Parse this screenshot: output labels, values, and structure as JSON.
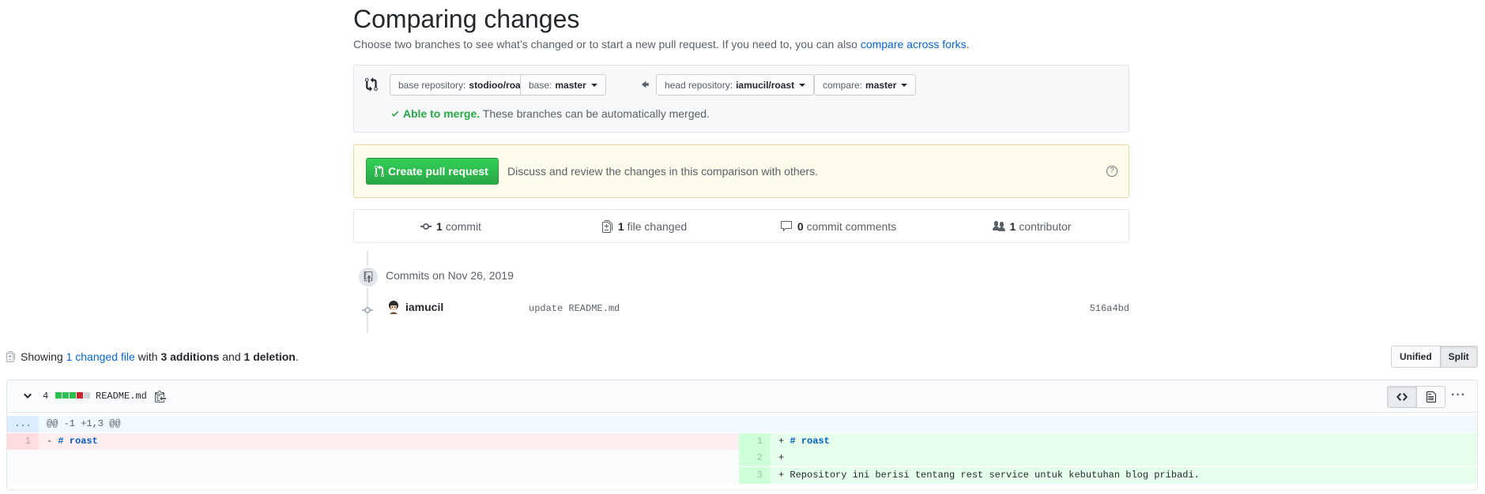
{
  "header": {
    "title": "Comparing changes",
    "subtitle_text": "Choose two branches to see what’s changed or to start a new pull request. If you need to, you can also",
    "subtitle_link": "compare across forks",
    "subtitle_end": "."
  },
  "range": {
    "base_repo_label": "base repository:",
    "base_repo_value": "stodioo/roast",
    "base_label": "base:",
    "base_value": "master",
    "head_repo_label": "head repository:",
    "head_repo_value": "iamucil/roast",
    "compare_label": "compare:",
    "compare_value": "master",
    "merge_ok": "Able to merge.",
    "merge_text": "These branches can be automatically merged."
  },
  "pull_request": {
    "button_label": "Create pull request",
    "description": "Discuss and review the changes in this comparison with others.",
    "help_glyph": "?"
  },
  "stats": {
    "commits_count": "1",
    "commits_label": "commit",
    "files_count": "1",
    "files_label": "file changed",
    "comments_count": "0",
    "comments_label": "commit comments",
    "contributors_count": "1",
    "contributors_label": "contributor"
  },
  "commits": {
    "date_heading": "Commits on Nov 26, 2019",
    "items": [
      {
        "author": "iamucil",
        "message": "update README.md",
        "sha": "516a4bd"
      }
    ]
  },
  "summary": {
    "prefix": "Showing",
    "files_link": "1 changed file",
    "with": "with",
    "additions": "3 additions",
    "and": "and",
    "deletions": "1 deletion",
    "end": "."
  },
  "view_toggle": {
    "unified": "Unified",
    "split": "Split",
    "selected": "Split"
  },
  "file": {
    "diff_count": "4",
    "name": "README.md",
    "diffstat_blocks": [
      "added",
      "added",
      "added",
      "deleted",
      "neutral"
    ],
    "more_glyph": "···",
    "hunk_expander": "...",
    "hunk_header": "@@ -1 +1,3 @@",
    "left_lines": [
      {
        "num": "1",
        "sign": "- ",
        "code": "# roast"
      }
    ],
    "right_lines": [
      {
        "num": "1",
        "sign": "+ ",
        "code": "# roast"
      },
      {
        "num": "2",
        "sign": "+",
        "code": ""
      },
      {
        "num": "3",
        "sign": "+ ",
        "code": "Repository ini berisi tentang rest service untuk kebutuhan blog pribadi."
      }
    ]
  },
  "colors": {
    "link": "#0366d6",
    "success": "#28a745",
    "deleted": "#cb2431",
    "added_bg": "#e6ffed",
    "deleted_bg": "#ffeef0"
  }
}
